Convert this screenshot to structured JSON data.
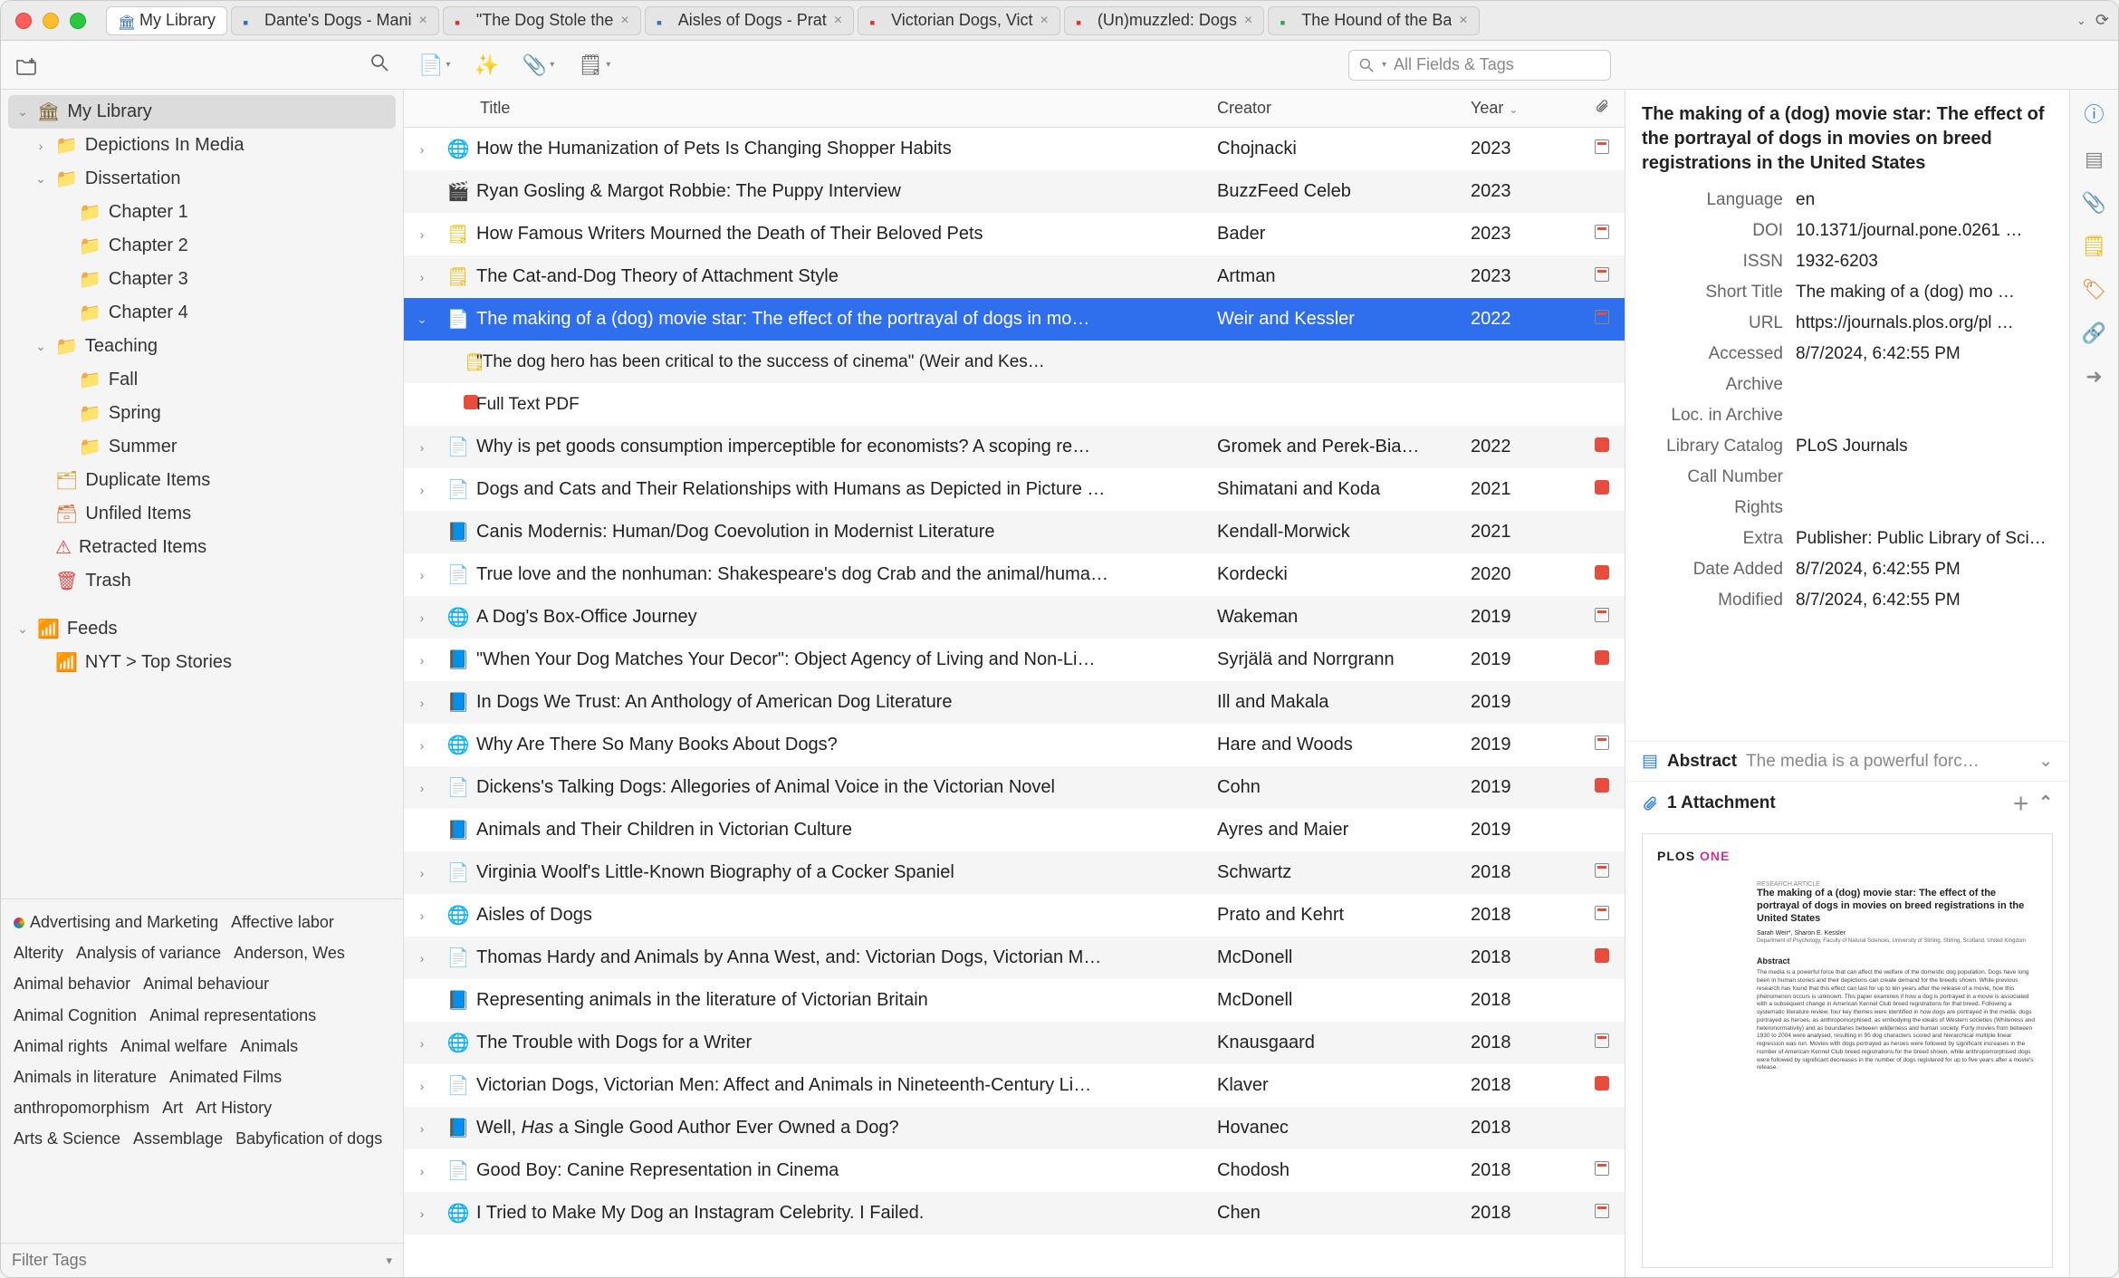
{
  "window": {
    "tabs": [
      {
        "label": "My Library",
        "active": true,
        "icon": "library"
      },
      {
        "label": "Dante's Dogs - Mani",
        "icon": "doc-blue"
      },
      {
        "label": "\"The Dog Stole the",
        "icon": "pdf"
      },
      {
        "label": "Aisles of Dogs - Prat",
        "icon": "doc-blue"
      },
      {
        "label": "Victorian Dogs, Vict",
        "icon": "pdf"
      },
      {
        "label": "(Un)muzzled: Dogs",
        "icon": "pdf"
      },
      {
        "label": "The Hound of the Ba",
        "icon": "doc-green"
      }
    ]
  },
  "toolbar": {
    "search_placeholder": "All Fields & Tags"
  },
  "sidebar": {
    "tree": [
      {
        "label": "My Library",
        "icon": "library",
        "twisty": "down",
        "depth": 0,
        "selected": true
      },
      {
        "label": "Depictions In Media",
        "icon": "folder",
        "twisty": "right",
        "depth": 1
      },
      {
        "label": "Dissertation",
        "icon": "folder",
        "twisty": "down",
        "depth": 1
      },
      {
        "label": "Chapter 1",
        "icon": "folder",
        "twisty": "",
        "depth": 2
      },
      {
        "label": "Chapter 2",
        "icon": "folder",
        "twisty": "",
        "depth": 2
      },
      {
        "label": "Chapter 3",
        "icon": "folder",
        "twisty": "",
        "depth": 2
      },
      {
        "label": "Chapter 4",
        "icon": "folder",
        "twisty": "",
        "depth": 2
      },
      {
        "label": "Teaching",
        "icon": "folder",
        "twisty": "down",
        "depth": 1
      },
      {
        "label": "Fall",
        "icon": "folder",
        "twisty": "",
        "depth": 2
      },
      {
        "label": "Spring",
        "icon": "folder",
        "twisty": "",
        "depth": 2
      },
      {
        "label": "Summer",
        "icon": "folder",
        "twisty": "",
        "depth": 2
      },
      {
        "label": "Duplicate Items",
        "icon": "dup",
        "twisty": "",
        "depth": 1
      },
      {
        "label": "Unfiled Items",
        "icon": "unfiled",
        "twisty": "",
        "depth": 1
      },
      {
        "label": "Retracted Items",
        "icon": "retr",
        "twisty": "",
        "depth": 1
      },
      {
        "label": "Trash",
        "icon": "trash",
        "twisty": "",
        "depth": 1
      },
      {
        "label": "Feeds",
        "icon": "feed",
        "twisty": "down",
        "depth": 0
      },
      {
        "label": "NYT > Top Stories",
        "icon": "feed",
        "twisty": "",
        "depth": 1
      }
    ],
    "tags": [
      "Advertising and Marketing",
      "Affective labor",
      "Alterity",
      "Analysis of variance",
      "Anderson, Wes",
      "Animal behavior",
      "Animal behaviour",
      "Animal Cognition",
      "Animal representations",
      "Animal rights",
      "Animal welfare",
      "Animals",
      "Animals in literature",
      "Animated Films",
      "anthropomorphism",
      "Art",
      "Art History",
      "Arts & Science",
      "Assemblage",
      "Babyfication of dogs"
    ],
    "tag_filter_placeholder": "Filter Tags"
  },
  "columns": {
    "title": "Title",
    "creator": "Creator",
    "year": "Year"
  },
  "items": [
    {
      "tw": "right",
      "icon": "web",
      "title": "How the Humanization of Pets Is Changing Shopper Habits",
      "creator": "Chojnacki",
      "year": "2023",
      "att": "cal"
    },
    {
      "tw": "",
      "icon": "video",
      "title": "Ryan Gosling & Margot Robbie: The Puppy Interview",
      "creator": "BuzzFeed Celeb",
      "year": "2023",
      "att": ""
    },
    {
      "tw": "right",
      "icon": "note",
      "title": "How Famous Writers Mourned the Death of Their Beloved Pets",
      "creator": "Bader",
      "year": "2023",
      "att": "cal"
    },
    {
      "tw": "right",
      "icon": "note",
      "title": "The Cat-and-Dog Theory of Attachment Style",
      "creator": "Artman",
      "year": "2023",
      "att": "cal"
    },
    {
      "tw": "down",
      "icon": "doc",
      "title": "The making of a (dog) movie star: The effect of the portrayal of dogs in mo…",
      "creator": "Weir and Kessler",
      "year": "2022",
      "att": "cal",
      "selected": true
    },
    {
      "tw": "",
      "icon": "note-child",
      "title": "\"The dog hero has been critical to the success of cinema\" (Weir and Kes…",
      "creator": "",
      "year": "",
      "att": "",
      "child": true
    },
    {
      "tw": "",
      "icon": "pdf-child",
      "title": "Full Text PDF",
      "creator": "",
      "year": "",
      "att": "",
      "child": true
    },
    {
      "tw": "right",
      "icon": "doc",
      "title": "Why is pet goods consumption imperceptible for economists? A scoping re…",
      "creator": "Gromek and Perek-Bia…",
      "year": "2022",
      "att": "pdf"
    },
    {
      "tw": "right",
      "icon": "doc",
      "title": "Dogs and Cats and Their Relationships with Humans as Depicted in Picture …",
      "creator": "Shimatani and Koda",
      "year": "2021",
      "att": "pdf"
    },
    {
      "tw": "",
      "icon": "book",
      "title": "Canis Modernis: Human/Dog Coevolution in Modernist Literature",
      "creator": "Kendall-Morwick",
      "year": "2021",
      "att": ""
    },
    {
      "tw": "right",
      "icon": "doc",
      "title": "True love and the nonhuman: Shakespeare's dog Crab and the animal/huma…",
      "creator": "Kordecki",
      "year": "2020",
      "att": "pdf"
    },
    {
      "tw": "right",
      "icon": "web",
      "title": "A Dog's Box-Office Journey",
      "creator": "Wakeman",
      "year": "2019",
      "att": "cal"
    },
    {
      "tw": "right",
      "icon": "book",
      "title": "\"When Your Dog Matches Your Decor\": Object Agency of Living and Non-Li…",
      "creator": "Syrjälä and Norrgrann",
      "year": "2019",
      "att": "pdf"
    },
    {
      "tw": "right",
      "icon": "book",
      "title": "In Dogs We Trust: An Anthology of American Dog Literature",
      "creator": "Ill and Makala",
      "year": "2019",
      "att": ""
    },
    {
      "tw": "right",
      "icon": "web",
      "title": "Why Are There So Many Books About Dogs?",
      "creator": "Hare and Woods",
      "year": "2019",
      "att": "cal"
    },
    {
      "tw": "right",
      "icon": "doc",
      "title": "Dickens's Talking Dogs: Allegories of Animal Voice in the Victorian Novel",
      "creator": "Cohn",
      "year": "2019",
      "att": "pdf"
    },
    {
      "tw": "",
      "icon": "book",
      "title": "Animals and Their Children in Victorian Culture",
      "creator": "Ayres and Maier",
      "year": "2019",
      "att": ""
    },
    {
      "tw": "right",
      "icon": "doc",
      "title": "Virginia Woolf's Little-Known Biography of a Cocker Spaniel",
      "creator": "Schwartz",
      "year": "2018",
      "att": "cal"
    },
    {
      "tw": "right",
      "icon": "web",
      "title": "Aisles of Dogs",
      "creator": "Prato and Kehrt",
      "year": "2018",
      "att": "cal"
    },
    {
      "tw": "right",
      "icon": "doc",
      "title": "Thomas Hardy and Animals by Anna West, and: Victorian Dogs, Victorian M…",
      "creator": "McDonell",
      "year": "2018",
      "att": "pdf"
    },
    {
      "tw": "",
      "icon": "book",
      "title": "Representing animals in the literature of Victorian Britain",
      "creator": "McDonell",
      "year": "2018",
      "att": ""
    },
    {
      "tw": "right",
      "icon": "web",
      "title": "The Trouble with Dogs for a Writer",
      "creator": "Knausgaard",
      "year": "2018",
      "att": "cal"
    },
    {
      "tw": "right",
      "icon": "doc",
      "title": "Victorian Dogs, Victorian Men: Affect and Animals in Nineteenth-Century Li…",
      "creator": "Klaver",
      "year": "2018",
      "att": "pdf"
    },
    {
      "tw": "right",
      "icon": "book",
      "title_html": "Well, <span class='italic'>Has</span> a Single Good Author Ever Owned a Dog?",
      "title": "Well, Has a Single Good Author Ever Owned a Dog?",
      "creator": "Hovanec",
      "year": "2018",
      "att": ""
    },
    {
      "tw": "right",
      "icon": "doc",
      "title": "Good Boy: Canine Representation in Cinema",
      "creator": "Chodosh",
      "year": "2018",
      "att": "cal"
    },
    {
      "tw": "right",
      "icon": "web",
      "title": "I Tried to Make My Dog an Instagram Celebrity. I Failed.",
      "creator": "Chen",
      "year": "2018",
      "att": "cal"
    }
  ],
  "info": {
    "title": "The making of a (dog) movie star: The effect of the portrayal of dogs in movies on breed registrations in the United States",
    "fields": [
      {
        "label": "Language",
        "value": "en"
      },
      {
        "label": "DOI",
        "value": "10.1371/journal.pone.0261 …"
      },
      {
        "label": "ISSN",
        "value": "1932-6203"
      },
      {
        "label": "Short Title",
        "value": "The making of a (dog) mo …"
      },
      {
        "label": "URL",
        "value": "https://journals.plos.org/pl …"
      },
      {
        "label": "Accessed",
        "value": "8/7/2024, 6:42:55 PM"
      },
      {
        "label": "Archive",
        "value": ""
      },
      {
        "label": "Loc. in Archive",
        "value": ""
      },
      {
        "label": "Library Catalog",
        "value": "PLoS Journals"
      },
      {
        "label": "Call Number",
        "value": ""
      },
      {
        "label": "Rights",
        "value": ""
      },
      {
        "label": "Extra",
        "value": "Publisher: Public Library of Science"
      },
      {
        "label": "Date Added",
        "value": "8/7/2024, 6:42:55 PM"
      },
      {
        "label": "Modified",
        "value": "8/7/2024, 6:42:55 PM"
      }
    ],
    "abstract_label": "Abstract",
    "abstract_text": "The media is a powerful forc…",
    "attachment_label": "1 Attachment",
    "preview_logo_a": "PLOS ",
    "preview_logo_b": "ONE"
  }
}
